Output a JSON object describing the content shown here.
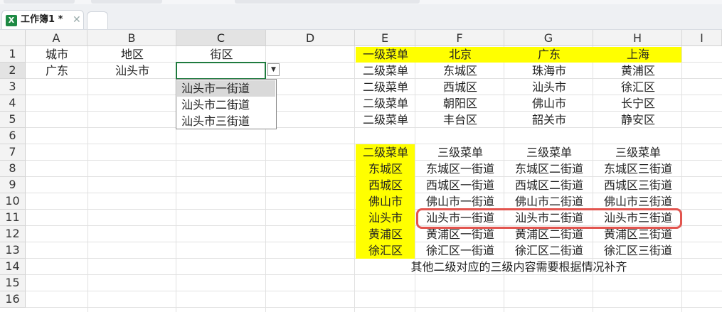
{
  "window": {
    "tab_title": "工作簿1 *",
    "file_icon": "excel-file-icon",
    "close_icon": "close-icon"
  },
  "columns": [
    "A",
    "B",
    "C",
    "D",
    "E",
    "F",
    "G",
    "H",
    "I"
  ],
  "rows": [
    "1",
    "2",
    "3",
    "4",
    "5",
    "6",
    "7",
    "8",
    "9",
    "10",
    "11",
    "12",
    "13",
    "14",
    "15",
    "16"
  ],
  "cells": {
    "A1": "城市",
    "B1": "地区",
    "C1": "街区",
    "A2": "广东",
    "B2": "汕头市",
    "E1": "一级菜单",
    "F1": "北京",
    "G1": "广东",
    "H1": "上海",
    "E2": "二级菜单",
    "F2": "东城区",
    "G2": "珠海市",
    "H2": "黄浦区",
    "E3": "二级菜单",
    "F3": "西城区",
    "G3": "汕头市",
    "H3": "徐汇区",
    "E4": "二级菜单",
    "F4": "朝阳区",
    "G4": "佛山市",
    "H4": "长宁区",
    "E5": "二级菜单",
    "F5": "丰台区",
    "G5": "韶关市",
    "H5": "静安区",
    "E7": "二级菜单",
    "F7": "三级菜单",
    "G7": "三级菜单",
    "H7": "三级菜单",
    "E8": "东城区",
    "F8": "东城区一街道",
    "G8": "东城区二街道",
    "H8": "东城区三街道",
    "E9": "西城区",
    "F9": "西城区一街道",
    "G9": "西城区二街道",
    "H9": "西城区三街道",
    "E10": "佛山市",
    "F10": "佛山市一街道",
    "G10": "佛山市二街道",
    "H10": "佛山市三街道",
    "E11": "汕头市",
    "F11": "汕头市一街道",
    "G11": "汕头市二街道",
    "H11": "汕头市三街道",
    "E12": "黄浦区",
    "F12": "黄浦区一街道",
    "G12": "黄浦区二街道",
    "H12": "黄浦区三街道",
    "E13": "徐汇区",
    "F13": "徐汇区一街道",
    "G13": "徐汇区二街道",
    "H13": "徐汇区三街道",
    "E14": "其他二级对应的三级内容需要根据情况补齐"
  },
  "dropdown": {
    "options": [
      "汕头市一街道",
      "汕头市二街道",
      "汕头市三街道"
    ],
    "highlighted_index": 0,
    "arrow_icon": "dropdown-arrow-icon"
  },
  "colors": {
    "fill_yellow": "#ffff00",
    "accent_green": "#1f7a3e",
    "annotation_red": "#e2554f"
  }
}
